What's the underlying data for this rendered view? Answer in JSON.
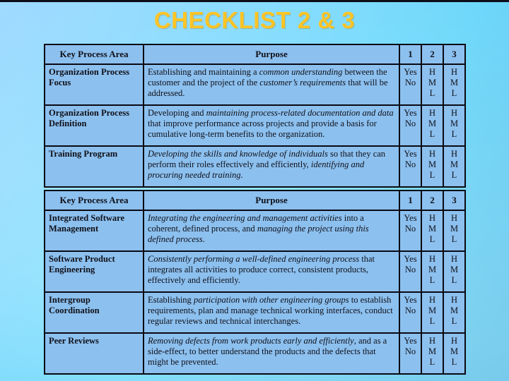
{
  "slide": {
    "title": "CHECKLIST 2 & 3",
    "title_color": "#FFC425",
    "background_color": "#8cc0ef",
    "table_fill_color": "#8cc0ef",
    "border_color": "#0a0a12"
  },
  "columns": {
    "kpa": "Key Process Area",
    "purpose": "Purpose",
    "n1": "1",
    "n2": "2",
    "n3": "3"
  },
  "ratings": {
    "yesno": [
      "Yes",
      "No"
    ],
    "hml": [
      "H",
      "M",
      "L"
    ]
  },
  "tables": [
    {
      "id": "table-1",
      "rows": [
        {
          "kpa": "Organization Process Focus",
          "purpose_html": "Establishing and maintaining a <i>common understanding</i> between the customer and the project of the <i>customer’s requirements</i> that will be addressed.",
          "purpose_text": "Establishing and maintaining a common understanding between the customer and the project of the customer’s requirements that will be addressed.",
          "col1": [
            "Yes",
            "No"
          ],
          "col2": [
            "H",
            "M",
            "L"
          ],
          "col3": [
            "H",
            "M",
            "L"
          ]
        },
        {
          "kpa": "Organization Process Definition",
          "purpose_html": "Developing and <i>maintaining process-related documentation and data</i> that improve performance across projects and provide a basis for cumulative long-term benefits to the organization.",
          "purpose_text": "Developing and maintaining process-related documentation and data that improve performance across projects and provide a basis for cumulative long-term benefits to the organization.",
          "col1": [
            "Yes",
            "No"
          ],
          "col2": [
            "H",
            "M",
            "L"
          ],
          "col3": [
            "H",
            "M",
            "L"
          ]
        },
        {
          "kpa": "Training Program",
          "purpose_html": "<i>Developing the skills and knowledge of individuals</i> so that they can perform their roles effectively and efficiently, <i>identifying and procuring needed training</i>.",
          "purpose_text": "Developing the skills and knowledge of individuals so that they can perform their roles effectively and efficiently, identifying and procuring needed training.",
          "col1": [
            "Yes",
            "No"
          ],
          "col2": [
            "H",
            "M",
            "L"
          ],
          "col3": [
            "H",
            "M",
            "L"
          ]
        }
      ]
    },
    {
      "id": "table-2",
      "rows": [
        {
          "kpa": "Integrated Software Management",
          "purpose_html": "<i>Integrating the engineering and management activities</i> into a coherent, defined process, and <i>managing the project using this defined process</i>.",
          "purpose_text": "Integrating the engineering and management activities into a coherent, defined process, and managing the project using this defined process.",
          "col1": [
            "Yes",
            "No"
          ],
          "col2": [
            "H",
            "M",
            "L"
          ],
          "col3": [
            "H",
            "M",
            "L"
          ]
        },
        {
          "kpa": "Software Product Engineering",
          "purpose_html": "<i>Consistently performing a well-defined engineering process</i> that integrates all activities to produce correct, consistent products, effectively and efficiently.",
          "purpose_text": "Consistently performing a well-defined engineering process that integrates all activities to produce correct, consistent products, effectively and efficiently.",
          "col1": [
            "Yes",
            "No"
          ],
          "col2": [
            "H",
            "M",
            "L"
          ],
          "col3": [
            "H",
            "M",
            "L"
          ]
        },
        {
          "kpa": "Intergroup Coordination",
          "purpose_html": "Establishing <i>participation with other engineering groups</i> to establish requirements, plan and manage technical working interfaces, conduct regular reviews and technical interchanges.",
          "purpose_text": "Establishing participation with other engineering groups to establish requirements, plan and manage technical working interfaces, conduct regular reviews and technical interchanges.",
          "col1": [
            "Yes",
            "No"
          ],
          "col2": [
            "H",
            "M",
            "L"
          ],
          "col3": [
            "H",
            "M",
            "L"
          ]
        },
        {
          "kpa": "Peer Reviews",
          "purpose_html": "<i>Removing defects from work products early and efficiently</i>, and as a side-effect, to better understand the products and the defects that might be prevented.",
          "purpose_text": "Removing defects from work products early and efficiently, and as a side-effect, to better understand the products and the defects that might be prevented.",
          "col1": [
            "Yes",
            "No"
          ],
          "col2": [
            "H",
            "M",
            "L"
          ],
          "col3": [
            "H",
            "M",
            "L"
          ]
        }
      ]
    }
  ]
}
